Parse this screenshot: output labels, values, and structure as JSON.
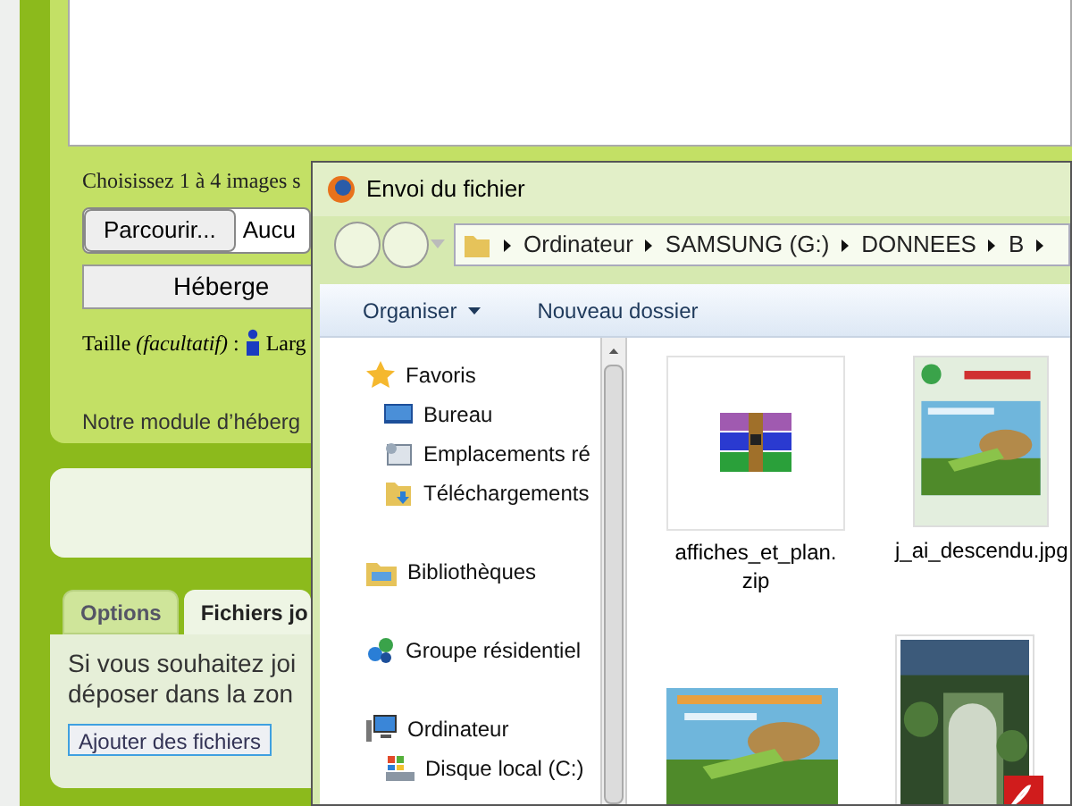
{
  "upload_form": {
    "instruction": "Choisissez 1 à 4 images s",
    "browse_button": "Parcourir...",
    "file_status": "Aucu",
    "submit_button": "Héberge",
    "size_label": "Taille *(facultatif)* :",
    "size_field_label": "Larg",
    "module_note": "Notre module d’héberg"
  },
  "attachments": {
    "tabs": [
      {
        "label": "Options",
        "selected": false
      },
      {
        "label": "Fichiers jo",
        "selected": true
      }
    ],
    "lines": [
      "Si vous souhaitez joi",
      "déposer dans la zon"
    ],
    "add_button": "Ajouter des fichiers"
  },
  "dialog": {
    "title": "Envoi du fichier",
    "breadcrumb": [
      "Ordinateur",
      "SAMSUNG (G:)",
      "DONNEES",
      "B"
    ],
    "toolbar": [
      {
        "label": "Organiser",
        "dropdown": true
      },
      {
        "label": "Nouveau dossier",
        "dropdown": false
      }
    ],
    "navigation": [
      {
        "label": "Favoris",
        "kind": "favorites",
        "children": [
          {
            "label": "Bureau",
            "kind": "desktop"
          },
          {
            "label": "Emplacements ré",
            "kind": "network"
          },
          {
            "label": "Téléchargements",
            "kind": "downloads"
          }
        ]
      },
      {
        "label": "Bibliothèques",
        "kind": "libraries"
      },
      {
        "label": "Groupe résidentiel",
        "kind": "homegroup"
      },
      {
        "label": "Ordinateur",
        "kind": "computer",
        "children": [
          {
            "label": "Disque local (C:)",
            "kind": "drive"
          }
        ]
      }
    ],
    "files": [
      {
        "name": "affiches_et_plan.zip",
        "kind": "archive"
      },
      {
        "name": "j_ai_descendu.jpg",
        "kind": "picture"
      },
      {
        "kind": "picture"
      },
      {
        "kind": "picture",
        "pdf": true
      }
    ]
  }
}
